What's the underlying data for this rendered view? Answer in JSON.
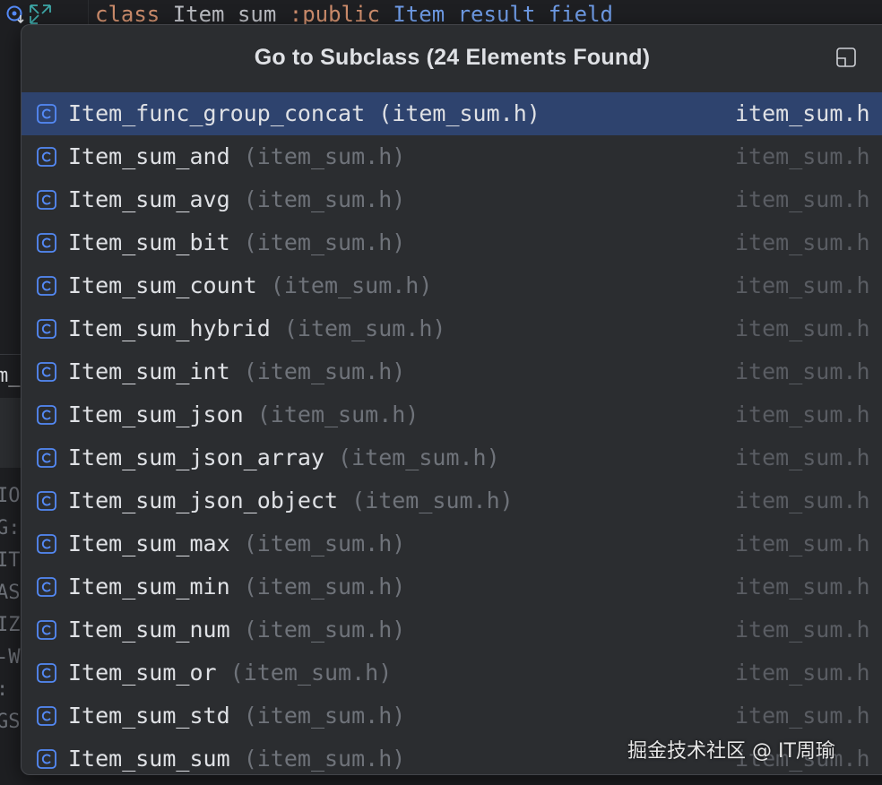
{
  "editor": {
    "code_line": {
      "keyword": "class",
      "class_name": "Item_sum",
      "colon_public": ":public",
      "base_class": "Item_result_field"
    },
    "tab_fragment": "m_",
    "gutter_fragments": [
      "IO",
      "G:",
      "IT",
      "AS",
      "IZ",
      "-W",
      ":",
      "GS"
    ]
  },
  "popup": {
    "title": "Go to Subclass (24 Elements Found)",
    "icons": {
      "pin": "pin-window-icon",
      "row": "class-icon"
    },
    "colors": {
      "selected_row": "#2e436e",
      "class_icon": "#548af7",
      "text": "#dfe1e5",
      "muted": "#6f737a"
    },
    "items": [
      {
        "name": "Item_func_group_concat",
        "location": "(item_sum.h)",
        "file": "item_sum.h",
        "selected": true
      },
      {
        "name": "Item_sum_and",
        "location": "(item_sum.h)",
        "file": "item_sum.h"
      },
      {
        "name": "Item_sum_avg",
        "location": "(item_sum.h)",
        "file": "item_sum.h"
      },
      {
        "name": "Item_sum_bit",
        "location": "(item_sum.h)",
        "file": "item_sum.h"
      },
      {
        "name": "Item_sum_count",
        "location": "(item_sum.h)",
        "file": "item_sum.h"
      },
      {
        "name": "Item_sum_hybrid",
        "location": "(item_sum.h)",
        "file": "item_sum.h"
      },
      {
        "name": "Item_sum_int",
        "location": "(item_sum.h)",
        "file": "item_sum.h"
      },
      {
        "name": "Item_sum_json",
        "location": "(item_sum.h)",
        "file": "item_sum.h"
      },
      {
        "name": "Item_sum_json_array",
        "location": "(item_sum.h)",
        "file": "item_sum.h"
      },
      {
        "name": "Item_sum_json_object",
        "location": "(item_sum.h)",
        "file": "item_sum.h"
      },
      {
        "name": "Item_sum_max",
        "location": "(item_sum.h)",
        "file": "item_sum.h"
      },
      {
        "name": "Item_sum_min",
        "location": "(item_sum.h)",
        "file": "item_sum.h"
      },
      {
        "name": "Item_sum_num",
        "location": "(item_sum.h)",
        "file": "item_sum.h"
      },
      {
        "name": "Item_sum_or",
        "location": "(item_sum.h)",
        "file": "item_sum.h"
      },
      {
        "name": "Item_sum_std",
        "location": "(item_sum.h)",
        "file": "item_sum.h"
      },
      {
        "name": "Item_sum_sum",
        "location": "(item_sum.h)",
        "file": "item_sum.h"
      }
    ]
  },
  "watermark": "掘金技术社区 @ IT周瑜"
}
